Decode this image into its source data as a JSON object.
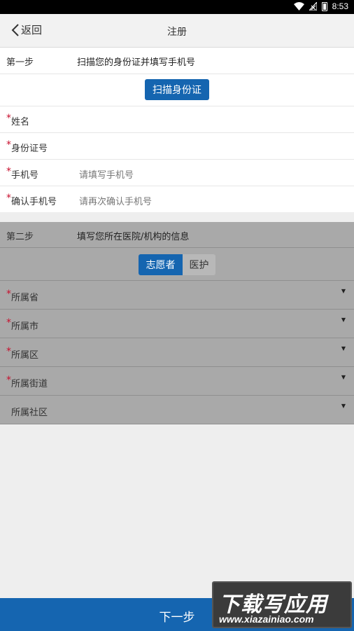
{
  "status_bar": {
    "time": "8:53"
  },
  "nav": {
    "back_label": "返回",
    "title": "注册"
  },
  "step1": {
    "label": "第一步",
    "description": "扫描您的身份证并填写手机号",
    "scan_button": "扫描身份证",
    "fields": [
      {
        "label": "姓名",
        "required": "*",
        "placeholder": ""
      },
      {
        "label": "身份证号",
        "required": "*",
        "placeholder": ""
      },
      {
        "label": "手机号",
        "required": "*",
        "placeholder": "请填写手机号"
      },
      {
        "label": "确认手机号",
        "required": "*",
        "placeholder": "请再次确认手机号"
      }
    ]
  },
  "step2": {
    "label": "第二步",
    "description": "填写您所在医院/机构的信息",
    "toggle": {
      "option_a": "志愿者",
      "option_b": "医护",
      "selected": "志愿者"
    },
    "selects": [
      {
        "label": "所属省",
        "required": "*"
      },
      {
        "label": "所属市",
        "required": "*"
      },
      {
        "label": "所属区",
        "required": "*"
      },
      {
        "label": "所属街道",
        "required": "*"
      },
      {
        "label": "所属社区",
        "required": ""
      }
    ]
  },
  "bottom": {
    "next_label": "下一步"
  },
  "watermark": {
    "main": "下载写应用",
    "sub": "www.xiazainiao.com"
  },
  "colors": {
    "primary": "#1565b0",
    "required": "#c8102e",
    "overlay": "#a9a9a9"
  }
}
